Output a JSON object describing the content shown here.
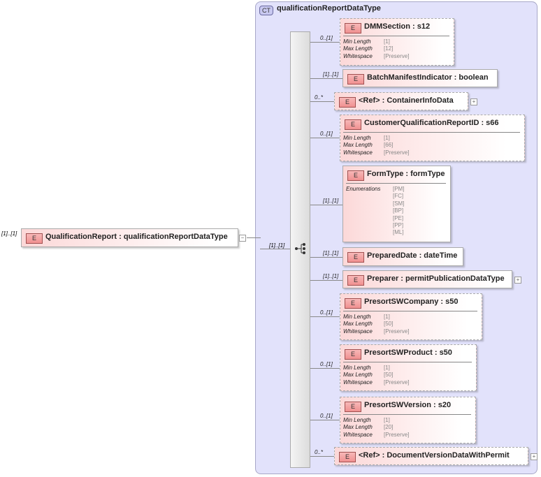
{
  "root": {
    "occurrence": "[1]..[1]",
    "badge": "E",
    "name": "QualificationReport : qualificationReportDataType",
    "toggle": "−"
  },
  "complex_type": {
    "badge": "CT",
    "name": "qualificationReportDataType",
    "sequence_occurrence": "[1]..[1]"
  },
  "facet_labels": {
    "min": "Min Length",
    "max": "Max Length",
    "ws": "Whitespace",
    "enum": "Enumerations"
  },
  "children": [
    {
      "name": "DMMSection : s12",
      "occurrence": "0..[1]",
      "optional": true,
      "facets": [
        "[1]",
        "[12]",
        "[Preserve]"
      ]
    },
    {
      "name": "BatchManifestIndicator : boolean",
      "occurrence": "[1]..[1]",
      "optional": false
    },
    {
      "name": "<Ref>     : ContainerInfoData",
      "occurrence": "0..*",
      "optional": true,
      "expand": "+"
    },
    {
      "name": "CustomerQualificationReportID : s66",
      "occurrence": "0..[1]",
      "optional": true,
      "facets": [
        "[1]",
        "[66]",
        "[Preserve]"
      ]
    },
    {
      "name": "FormType : formType",
      "occurrence": "[1]..[1]",
      "optional": false,
      "enumerations": [
        "[PM]",
        "[FC]",
        "[SM]",
        "[BP]",
        "[PE]",
        "[PP]",
        "[ML]"
      ]
    },
    {
      "name": "PreparedDate : dateTime",
      "occurrence": "[1]..[1]",
      "optional": false
    },
    {
      "name": "Preparer : permitPublicationDataType",
      "occurrence": "[1]..[1]",
      "optional": false,
      "expand": "+"
    },
    {
      "name": "PresortSWCompany : s50",
      "occurrence": "0..[1]",
      "optional": true,
      "facets": [
        "[1]",
        "[50]",
        "[Preserve]"
      ]
    },
    {
      "name": "PresortSWProduct : s50",
      "occurrence": "0..[1]",
      "optional": true,
      "facets": [
        "[1]",
        "[50]",
        "[Preserve]"
      ]
    },
    {
      "name": "PresortSWVersion : s20",
      "occurrence": "0..[1]",
      "optional": true,
      "facets": [
        "[1]",
        "[20]",
        "[Preserve]"
      ]
    },
    {
      "name": "<Ref>     : DocumentVersionDataWithPermit",
      "occurrence": "0..*",
      "optional": true,
      "expand": "+"
    }
  ]
}
